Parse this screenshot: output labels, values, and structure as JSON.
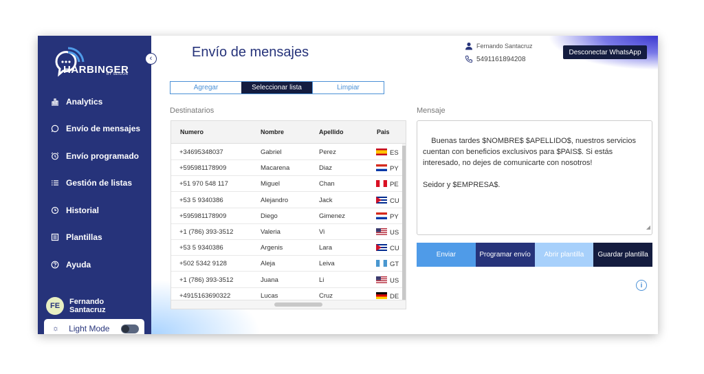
{
  "brand": {
    "name": "HARBINGER",
    "subtitle": "BY SEIDOR"
  },
  "sidebar": {
    "collapse_glyph": "‹",
    "items": [
      {
        "label": "Analytics",
        "icon": "chart-icon"
      },
      {
        "label": "Envío de mensajes",
        "icon": "whatsapp-icon"
      },
      {
        "label": "Envío programado",
        "icon": "alarm-clock-icon"
      },
      {
        "label": "Gestión de listas",
        "icon": "list-icon"
      },
      {
        "label": "Historial",
        "icon": "history-icon"
      },
      {
        "label": "Plantillas",
        "icon": "template-icon"
      },
      {
        "label": "Ayuda",
        "icon": "help-icon"
      }
    ],
    "user": {
      "initials": "FE",
      "name": "Fernando Santacruz"
    },
    "light_mode_label": "Light Mode"
  },
  "header": {
    "title": "Envío de mensajes",
    "user_name": "Fernando Santacruz",
    "phone": "5491161894208",
    "disconnect_label": "Desconectar WhatsApp"
  },
  "tabs": [
    {
      "label": "Agregar",
      "active": false
    },
    {
      "label": "Seleccionar lista",
      "active": true
    },
    {
      "label": "Limpiar",
      "active": false
    }
  ],
  "recipients": {
    "label": "Destinatarios",
    "columns": [
      "Numero",
      "Nombre",
      "Apellido",
      "Pais"
    ],
    "rows": [
      {
        "numero": "+34695348037",
        "nombre": "Gabriel",
        "apellido": "Perez",
        "pais": "ES"
      },
      {
        "numero": "+595981178909",
        "nombre": "Macarena",
        "apellido": "Diaz",
        "pais": "PY"
      },
      {
        "numero": "+51 970 548 117",
        "nombre": "Miguel",
        "apellido": "Chan",
        "pais": "PE"
      },
      {
        "numero": "+53 5 9340386",
        "nombre": "Alejandro",
        "apellido": "Jack",
        "pais": "CU"
      },
      {
        "numero": "+595981178909",
        "nombre": "Diego",
        "apellido": "Gimenez",
        "pais": "PY"
      },
      {
        "numero": "+1 (786) 393-3512",
        "nombre": "Valeria",
        "apellido": "Vi",
        "pais": "US"
      },
      {
        "numero": "+53 5 9340386",
        "nombre": "Argenis",
        "apellido": "Lara",
        "pais": "CU"
      },
      {
        "numero": "+502 5342 9128",
        "nombre": "Aleja",
        "apellido": "Leiva",
        "pais": "GT"
      },
      {
        "numero": "+1 (786) 393-3512",
        "nombre": "Juana",
        "apellido": "Li",
        "pais": "US"
      },
      {
        "numero": "+4915163690322",
        "nombre": "Lucas",
        "apellido": "Cruz",
        "pais": "DE"
      }
    ]
  },
  "message": {
    "label": "Mensaje",
    "text": "Buenas tardes $NOMBRE$ $APELLIDO$, nuestros servicios cuentan con beneficios exclusivos para $PAIS$. Si estás interesado, no dejes de comunicarte con nosotros!\n\nSeidor y $EMPRESA$."
  },
  "actions": [
    {
      "label": "Enviar",
      "color": "#4f9be8"
    },
    {
      "label": "Programar envío",
      "color": "#26337a"
    },
    {
      "label": "Abrir plantilla",
      "color": "#a7d0fb"
    },
    {
      "label": "Guardar plantilla",
      "color": "#141c3f"
    }
  ],
  "info_glyph": "i",
  "colors": {
    "sidebar": "#26337a",
    "accent": "#4a90d6",
    "dark": "#141c3f"
  }
}
